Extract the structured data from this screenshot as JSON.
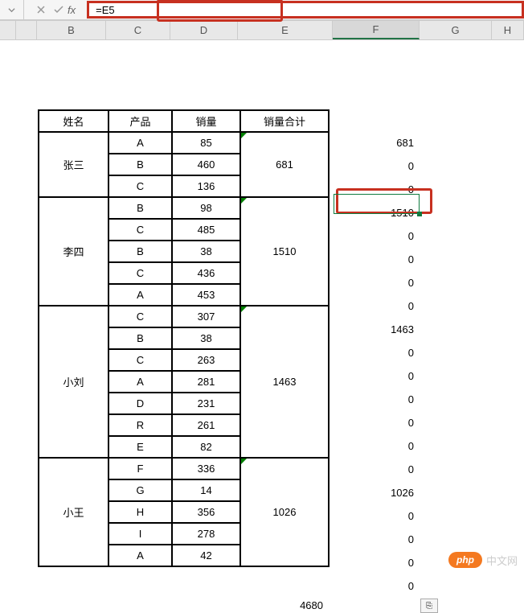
{
  "formula": "=E5",
  "fx_label": "fx",
  "columns": [
    "B",
    "C",
    "D",
    "E",
    "F",
    "G",
    "H"
  ],
  "headers": {
    "name": "姓名",
    "product": "产品",
    "sales": "销量",
    "total": "销量合计"
  },
  "groups": [
    {
      "name": "张三",
      "total": 681,
      "rows": [
        {
          "p": "A",
          "s": 85
        },
        {
          "p": "B",
          "s": 460
        },
        {
          "p": "C",
          "s": 136
        }
      ]
    },
    {
      "name": "李四",
      "total": 1510,
      "rows": [
        {
          "p": "B",
          "s": 98
        },
        {
          "p": "C",
          "s": 485
        },
        {
          "p": "B",
          "s": 38
        },
        {
          "p": "C",
          "s": 436
        },
        {
          "p": "A",
          "s": 453
        }
      ]
    },
    {
      "name": "小刘",
      "total": 1463,
      "rows": [
        {
          "p": "C",
          "s": 307
        },
        {
          "p": "B",
          "s": 38
        },
        {
          "p": "C",
          "s": 263
        },
        {
          "p": "A",
          "s": 281
        },
        {
          "p": "D",
          "s": 231
        },
        {
          "p": "R",
          "s": 261
        },
        {
          "p": "E",
          "s": 82
        }
      ]
    },
    {
      "name": "小王",
      "total": 1026,
      "rows": [
        {
          "p": "F",
          "s": 336
        },
        {
          "p": "G",
          "s": 14
        },
        {
          "p": "H",
          "s": 356
        },
        {
          "p": "I",
          "s": 278
        },
        {
          "p": "A",
          "s": 42
        }
      ]
    }
  ],
  "f_values": [
    681,
    0,
    0,
    1510,
    0,
    0,
    0,
    0,
    1463,
    0,
    0,
    0,
    0,
    0,
    0,
    1026,
    0,
    0,
    0,
    0
  ],
  "grand_total": 4680,
  "watermark": {
    "logo": "php",
    "text": "中文网"
  },
  "paste_icon": "⎘"
}
